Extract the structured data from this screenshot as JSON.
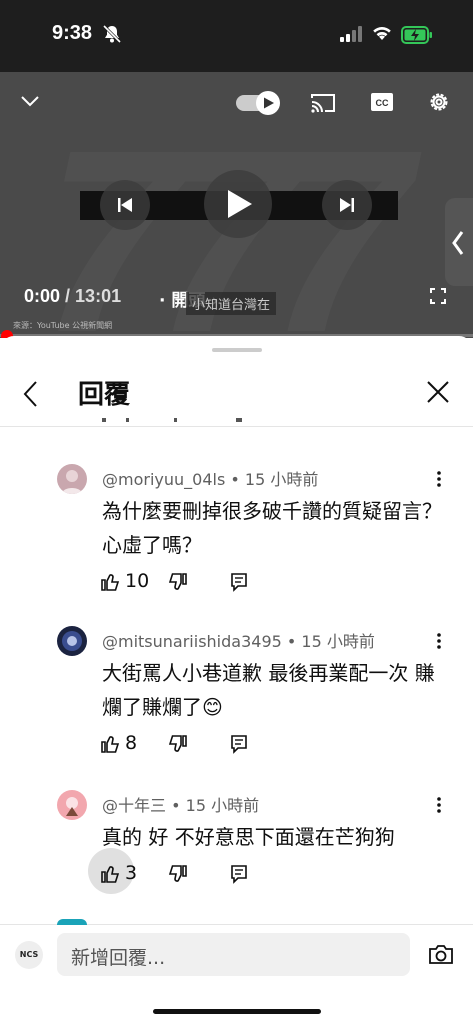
{
  "status_bar": {
    "time": "9:38"
  },
  "video": {
    "current_time": "0:00",
    "duration": "/ 13:01",
    "chapter": "· 開頭",
    "caption": "小知道台灣在",
    "source": "來源：YouTube 公視新聞網"
  },
  "replies_panel": {
    "title": "回覆",
    "comments": [
      {
        "user": "@moriyuu_04ls",
        "age": "• 15 小時前",
        "text": "為什麼要刪掉很多破千讚的質疑留言？心虛了嗎？",
        "likes": "10"
      },
      {
        "user": "@mitsunariishida3495",
        "age": "• 15 小時前",
        "text": "大街罵人小巷道歉 最後再業配一次 賺爛了賺爛了😊",
        "likes": "8"
      },
      {
        "user": "@十年三",
        "age": "• 15 小時前",
        "text": "真的 好 不好意思下面還在芒狗狗",
        "likes": "3"
      }
    ]
  },
  "composer": {
    "avatar_label": "NCS",
    "placeholder": "新增回覆..."
  },
  "colors": {
    "progress": "#ff0000",
    "statusbar": "#1e1e1e",
    "battery": "#34c759"
  }
}
